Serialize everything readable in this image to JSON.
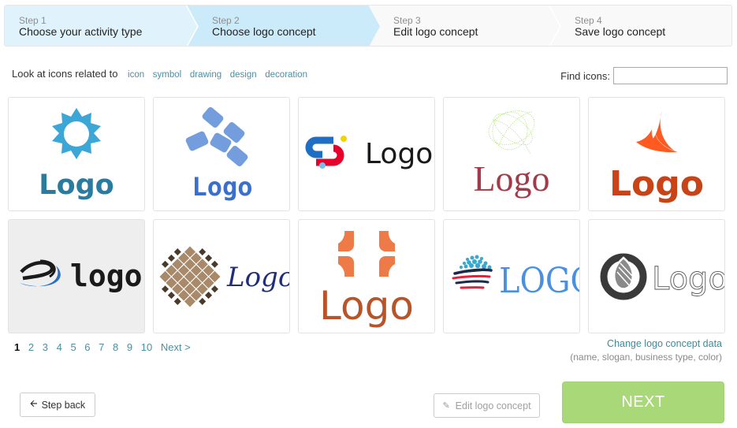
{
  "steps": [
    {
      "number": "Step 1",
      "title": "Choose your activity type",
      "state": "done",
      "color": "#e0f3fc"
    },
    {
      "number": "Step 2",
      "title": "Choose logo concept",
      "state": "active",
      "color": "#cbebfb"
    },
    {
      "number": "Step 3",
      "title": "Edit logo concept",
      "state": "pending",
      "color": "#f9f9f9"
    },
    {
      "number": "Step 4",
      "title": "Save logo concept",
      "state": "pending",
      "color": "#f9f9f9"
    }
  ],
  "related": {
    "label": "Look at icons related to",
    "tags": [
      "icon",
      "symbol",
      "drawing",
      "design",
      "decoration"
    ]
  },
  "search": {
    "label": "Find icons:",
    "value": "",
    "placeholder": ""
  },
  "logos": [
    {
      "id": "sun-logo",
      "text": "Logo",
      "color": "#2a7ba0",
      "icon_color": "#3ca6d6",
      "selected": false
    },
    {
      "id": "diamonds-logo",
      "text": "Logo",
      "color": "#3a6fcc",
      "icon_color": "#739ddd",
      "selected": false
    },
    {
      "id": "link-logo",
      "text": "Logo",
      "color": "#1a1a1a",
      "icon_colors": [
        "#1e6fc2",
        "#e8002d",
        "#f2d500",
        "#73c0ec"
      ],
      "selected": false
    },
    {
      "id": "mesh-logo",
      "text": "Logo",
      "color": "#a33a4a",
      "icon_color": "#a8d86a",
      "selected": false
    },
    {
      "id": "wing-logo",
      "text": "Logo",
      "color": "#c84418",
      "icon_color": "#ff5a1f",
      "selected": false
    },
    {
      "id": "swirl-logo",
      "text": "logo",
      "color": "#1a1a1a",
      "icon_colors": [
        "#1a1a1a",
        "#2a6dc4"
      ],
      "selected": true
    },
    {
      "id": "checker-logo",
      "text": "Logo",
      "color": "#1f2d7a",
      "icon_colors": [
        "#a8896a",
        "#4a3a2a"
      ],
      "selected": false
    },
    {
      "id": "cross-logo",
      "text": "Logo",
      "color": "#b85428",
      "icon_color": "#ee7a48",
      "selected": false
    },
    {
      "id": "globe-logo",
      "text": "LOGO",
      "color": "#4a8fe0",
      "icon_colors": [
        "#38a8d0",
        "#1a2a4a",
        "#e8203a"
      ],
      "selected": false
    },
    {
      "id": "drop-logo",
      "text": "Logo",
      "color": "#555555",
      "icon_colors": [
        "#3a3a3a",
        "#8a8a8a"
      ],
      "selected": false
    }
  ],
  "pagination": {
    "pages": [
      "1",
      "2",
      "3",
      "4",
      "5",
      "6",
      "7",
      "8",
      "9",
      "10"
    ],
    "current": "1",
    "next_label": "Next >"
  },
  "change_data": {
    "link": "Change logo concept data",
    "hint": "(name, slogan, business type, color)"
  },
  "buttons": {
    "back": "Step back",
    "edit": "Edit logo concept",
    "next": "NEXT"
  },
  "colors": {
    "link": "#4d8fa0",
    "next_button": "#a9d878"
  }
}
